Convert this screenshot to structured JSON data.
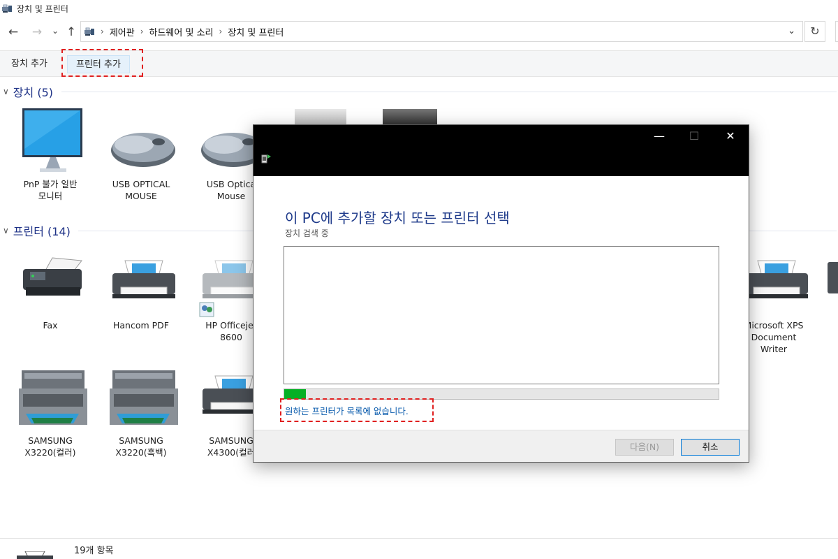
{
  "window": {
    "title": "장치 및 프린터"
  },
  "nav": {
    "back": "←",
    "forward": "→",
    "recent": "⌄",
    "up": "↑",
    "breadcrumbs": [
      "제어판",
      "하드웨어 및 소리",
      "장치 및 프린터"
    ],
    "separator": "›",
    "dropdown": "⌄",
    "refresh": "↻"
  },
  "toolbar": {
    "add_device": "장치 추가",
    "add_printer": "프린터 추가"
  },
  "groups": {
    "devices": {
      "chevron": "∨",
      "label": "장치 (5)"
    },
    "printers": {
      "chevron": "∨",
      "label": "프린터 (14)"
    }
  },
  "devices": [
    {
      "line1": "PnP 불가 일반",
      "line2": "모니터",
      "icon": "monitor-icon"
    },
    {
      "line1": "USB OPTICAL",
      "line2": "MOUSE",
      "icon": "mouse-icon"
    },
    {
      "line1": "USB Optica",
      "line2": "Mouse",
      "icon": "mouse-icon"
    }
  ],
  "printers": [
    {
      "line1": "Fax",
      "line2": "",
      "icon": "fax-icon"
    },
    {
      "line1": "Hancom PDF",
      "line2": "",
      "icon": "printer-icon"
    },
    {
      "line1": "HP Officejet",
      "line2": "8600",
      "icon": "printer-icon"
    },
    {
      "line1": "Microsoft XPS",
      "line2": "Document",
      "line3": "Writer",
      "icon": "printer-icon"
    },
    {
      "line1": "SAMSUNG",
      "line2": "X3220(컬러)",
      "icon": "mfp-printer-icon"
    },
    {
      "line1": "SAMSUNG",
      "line2": "X3220(흑백)",
      "icon": "mfp-printer-icon"
    },
    {
      "line1": "SAMSUNG",
      "line2": "X4300(컬러",
      "icon": "printer-icon"
    }
  ],
  "status": {
    "count": "19개 항목"
  },
  "dialog": {
    "minimize": "—",
    "maximize": "☐",
    "close": "✕",
    "heading": "이 PC에 추가할 장치 또는 프린터 선택",
    "subtitle": "장치 검색 중",
    "progress": 0.05,
    "not_listed_link": "원하는 프린터가 목록에 없습니다.",
    "next_button": "다음(N)",
    "cancel_button": "취소"
  },
  "colors": {
    "highlight_box": "#e02020",
    "progress_fill": "#06b025",
    "heading": "#1e3a8a",
    "link": "#0b5cad"
  }
}
